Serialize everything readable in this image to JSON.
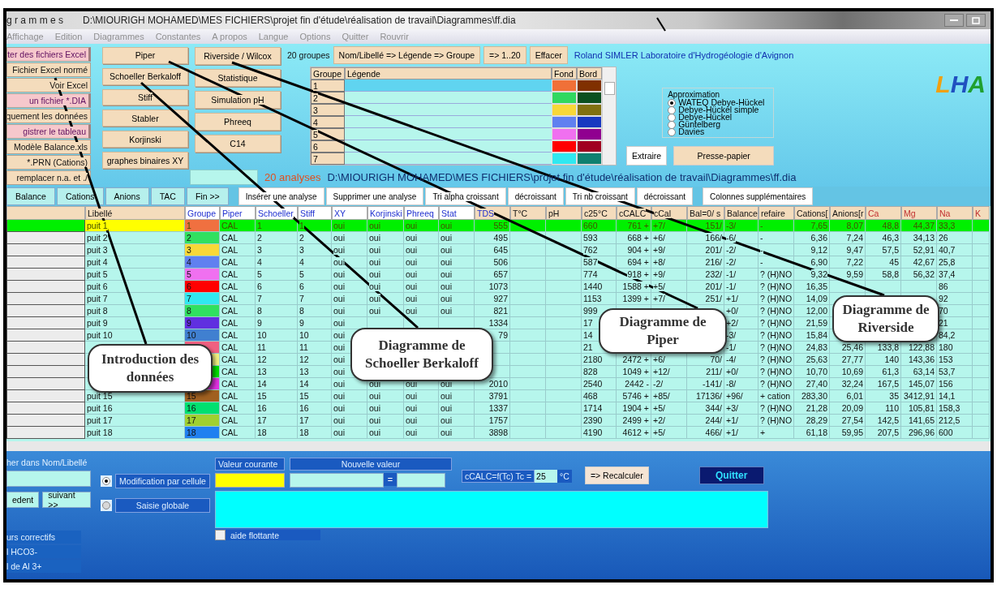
{
  "window": {
    "title": "g r a m m e s",
    "path": "D:\\MIOURIGH MOHAMED\\MES FICHIERS\\projet fin d'étude\\réalisation de travail\\Diagrammes\\ff.dia"
  },
  "menu": [
    "Affichage",
    "Edition",
    "Diagrammes",
    "Constantes",
    "A propos",
    "Langue",
    "Options",
    "Quitter",
    "Rouvrir"
  ],
  "file_buttons": [
    {
      "label": "ter des fichiers Excel",
      "kind": "pink"
    },
    {
      "label": "Fichier Excel normé",
      "kind": "beige"
    },
    {
      "label": "Voir Excel",
      "kind": "beige"
    },
    {
      "label": "un fichier *.DIA",
      "kind": "pink"
    },
    {
      "label": "quement les données",
      "kind": "beige"
    },
    {
      "label": "gistrer le tableau",
      "kind": "pink"
    },
    {
      "label": "Modèle Balance.xls",
      "kind": "beige"
    },
    {
      "label": "*.PRN (Cations)",
      "kind": "beige"
    },
    {
      "label": "remplacer n.a. et ./",
      "kind": "beige"
    }
  ],
  "diagram_buttons": [
    [
      "Piper",
      "Schoeller Berkaloff",
      "Stiff",
      "Stabler",
      "Korjinski",
      "graphes binaires XY"
    ],
    [
      "Riverside / Wilcox",
      "Statistique",
      "Simulation pH",
      "Phreeq",
      "C14"
    ]
  ],
  "groups": {
    "count_label": "20 groupes",
    "buttons": [
      "Nom/Libellé => Légende => Groupe",
      "=> 1..20",
      "Effacer"
    ],
    "credit": "Roland SIMLER Laboratoire d'Hydrogéologie d'Avignon",
    "columns": [
      "Groupe",
      "Légende",
      "Fond",
      "Bord"
    ],
    "rows": [
      {
        "group": "1",
        "selected": true,
        "swatches": [
          {
            "color": "#f07038"
          },
          {
            "color": "#803000"
          }
        ]
      },
      {
        "group": "2",
        "selected": false,
        "swatches": [
          {
            "color": "#30d860"
          },
          {
            "color": "#0a5020"
          }
        ]
      },
      {
        "group": "3",
        "selected": false,
        "swatches": [
          {
            "color": "#f8d838"
          },
          {
            "color": "#807010"
          }
        ]
      },
      {
        "group": "4",
        "selected": false,
        "swatches": [
          {
            "color": "#6080f0"
          },
          {
            "color": "#1838c0"
          }
        ]
      },
      {
        "group": "5",
        "selected": false,
        "swatches": [
          {
            "color": "#f070f0"
          },
          {
            "color": "#900090"
          }
        ]
      },
      {
        "group": "6",
        "selected": false,
        "swatches": [
          {
            "color": "#ff0000"
          },
          {
            "color": "#a00020"
          }
        ]
      },
      {
        "group": "7",
        "selected": false,
        "swatches": [
          {
            "color": "#30e8f0"
          },
          {
            "color": "#108070"
          }
        ]
      }
    ]
  },
  "approximation": {
    "title": "Approximation",
    "options": [
      {
        "label": "WATEQ Debye-Hückel",
        "selected": true
      },
      {
        "label": "Debye-Hückel simple",
        "selected": false
      },
      {
        "label": "Debye-Hückel",
        "selected": false
      },
      {
        "label": "Güntelberg",
        "selected": false
      },
      {
        "label": "Davies",
        "selected": false
      }
    ]
  },
  "extract_buttons": [
    "Extraire",
    "Presse-papier"
  ],
  "logo": [
    {
      "text": "L",
      "color": "#f0a010"
    },
    {
      "text": "H",
      "color": "#2050c0"
    },
    {
      "text": "A",
      "color": "#20a030"
    }
  ],
  "analyses": {
    "count": "20 analyses",
    "path": "D:\\MIOURIGH MOHAMED\\MES FICHIERS\\projet fin d'étude\\réalisation de travail\\Diagrammes\\ff.dia"
  },
  "tabs": [
    "Balance",
    "Cations",
    "Anions",
    "TAC",
    "Fin >>"
  ],
  "actions": [
    "Insérer une analyse",
    "Supprimer une analyse",
    "Tri alpha croissant",
    "décroissant",
    "Tri nb croissant",
    "décroissant",
    "Colonnes supplémentaires"
  ],
  "table": {
    "columns": [
      {
        "label": "Libellé",
        "kind": "plain"
      },
      {
        "label": "Groupe",
        "kind": "link"
      },
      {
        "label": "Piper",
        "kind": "link"
      },
      {
        "label": "Schoeller",
        "kind": "link"
      },
      {
        "label": "Stiff",
        "kind": "link"
      },
      {
        "label": "XY",
        "kind": "link"
      },
      {
        "label": "Korjinski",
        "kind": "link"
      },
      {
        "label": "Phreeq",
        "kind": "link"
      },
      {
        "label": "Stat",
        "kind": "link"
      },
      {
        "label": "TDS",
        "kind": "blue"
      },
      {
        "label": "T°C",
        "kind": "plain"
      },
      {
        "label": "pH",
        "kind": "plain"
      },
      {
        "label": "c25°C",
        "kind": "plain"
      },
      {
        "label": "cCALC",
        "kind": "plain"
      },
      {
        "label": "cCal",
        "kind": "plain"
      },
      {
        "label": "Bal=0/ s",
        "kind": "plain"
      },
      {
        "label": "Balance",
        "kind": "plain"
      },
      {
        "label": "refaire",
        "kind": "plain"
      },
      {
        "label": "Cations[",
        "kind": "plain"
      },
      {
        "label": "Anions[r",
        "kind": "plain"
      },
      {
        "label": "Ca",
        "kind": "ion"
      },
      {
        "label": "Mg",
        "kind": "ion"
      },
      {
        "label": "Na",
        "kind": "ion"
      },
      {
        "label": "K",
        "kind": "ion"
      }
    ],
    "rows": [
      {
        "selected": true,
        "color": "#f07040",
        "cells": [
          "puit 1",
          "1",
          "CAL",
          "1",
          "1",
          "oui",
          "oui",
          "oui",
          "oui",
          "555",
          null,
          null,
          "660",
          "761 +",
          "+7/",
          "151/",
          "-3/",
          "-",
          "7,65",
          "8,07",
          "48,8",
          "44,37",
          "33,3",
          null
        ]
      },
      {
        "selected": false,
        "color": "#30e060",
        "cells": [
          "puit 2",
          "2",
          "CAL",
          "2",
          "2",
          "oui",
          "oui",
          "oui",
          "oui",
          "495",
          null,
          null,
          "593",
          "668 +",
          "+6/",
          "166/",
          "-6/",
          "-",
          "6,36",
          "7,24",
          "46,3",
          "34,13",
          "26",
          null
        ]
      },
      {
        "selected": false,
        "color": "#f8d838",
        "cells": [
          "puit 3",
          "3",
          "CAL",
          "3",
          "3",
          "oui",
          "oui",
          "oui",
          "oui",
          "645",
          null,
          null,
          "762",
          "904 +",
          "+9/",
          "201/",
          "-2/",
          "-",
          "9,12",
          "9,47",
          "57,5",
          "52,91",
          "40,7",
          null
        ]
      },
      {
        "selected": false,
        "color": "#6080f0",
        "cells": [
          "puit 4",
          "4",
          "CAL",
          "4",
          "4",
          "oui",
          "oui",
          "oui",
          "oui",
          "506",
          null,
          null,
          "587",
          "694 +",
          "+8/",
          "216/",
          "-2/",
          "-",
          "6,90",
          "7,22",
          "45",
          "42,67",
          "25,8",
          null
        ]
      },
      {
        "selected": false,
        "color": "#f070f0",
        "cells": [
          "puit 5",
          "5",
          "CAL",
          "5",
          "5",
          "oui",
          "oui",
          "oui",
          "oui",
          "657",
          null,
          null,
          "774",
          "918 +",
          "+9/",
          "232/",
          "-1/",
          "? (H)NO",
          "9,32",
          "9,59",
          "58,8",
          "56,32",
          "37,4",
          null
        ]
      },
      {
        "selected": false,
        "color": "#ff0000",
        "cells": [
          "puit 6",
          "6",
          "CAL",
          "6",
          "6",
          "oui",
          "oui",
          "oui",
          "oui",
          "1073",
          null,
          null,
          "1440",
          "1588 +",
          "+5/",
          "201/",
          "-1/",
          "? (H)NO",
          "16,35",
          null,
          null,
          null,
          "86",
          null
        ]
      },
      {
        "selected": false,
        "color": "#30e8f0",
        "cells": [
          "puit 7",
          "7",
          "CAL",
          "7",
          "7",
          "oui",
          "oui",
          "oui",
          "oui",
          "927",
          null,
          null,
          "1153",
          "1399 +",
          "+7/",
          "251/",
          "+1/",
          "? (H)NO",
          "14,09",
          null,
          null,
          null,
          "92",
          null
        ]
      },
      {
        "selected": false,
        "color": "#30e060",
        "cells": [
          "puit 8",
          "8",
          "CAL",
          "8",
          "8",
          "oui",
          "oui",
          "oui",
          "oui",
          "821",
          null,
          null,
          "999",
          null,
          null,
          null,
          "+0/",
          "? (H)NO",
          "12,00",
          null,
          null,
          null,
          "70",
          null
        ]
      },
      {
        "selected": false,
        "color": "#6030e0",
        "cells": [
          "puit 9",
          "9",
          "CAL",
          "9",
          "9",
          "oui",
          null,
          null,
          null,
          "1334",
          null,
          null,
          "17",
          null,
          null,
          null,
          "+2/",
          "? (H)NO",
          "21,59",
          null,
          null,
          null,
          "21",
          null
        ]
      },
      {
        "selected": false,
        "color": "#4080d0",
        "cells": [
          "puit 10",
          "10",
          "CAL",
          "10",
          "10",
          "oui",
          null,
          null,
          null,
          "79",
          null,
          null,
          "14",
          null,
          null,
          null,
          "-3/",
          "? (H)NO",
          "15,84",
          null,
          null,
          null,
          "84,2",
          null
        ]
      },
      {
        "selected": false,
        "color": "#f06080",
        "cells": [
          null,
          null,
          "CAL",
          "11",
          "11",
          "oui",
          null,
          null,
          null,
          null,
          null,
          null,
          "21",
          null,
          null,
          null,
          "-1/",
          "? (H)NO",
          "24,83",
          "25,46",
          "133,8",
          "122,88",
          "180",
          null
        ]
      },
      {
        "selected": false,
        "color": "#f0f080",
        "cells": [
          null,
          null,
          "CAL",
          "12",
          "12",
          "oui",
          null,
          null,
          null,
          null,
          null,
          null,
          "2180",
          "2472 +",
          "+6/",
          "70/",
          "-4/",
          "? (H)NO",
          "25,63",
          "27,77",
          "140",
          "143,36",
          "153",
          null
        ]
      },
      {
        "selected": false,
        "color": "#00e000",
        "cells": [
          null,
          null,
          "CAL",
          "13",
          "13",
          "oui",
          null,
          null,
          null,
          null,
          null,
          null,
          "828",
          "1049 +",
          "+12/",
          "211/",
          "+0/",
          "? (H)NO",
          "10,70",
          "10,69",
          "61,3",
          "63,14",
          "53,7",
          null
        ]
      },
      {
        "selected": false,
        "color": "#e030e0",
        "cells": [
          null,
          null,
          "CAL",
          "14",
          "14",
          "oui",
          "oui",
          "oui",
          "oui",
          "2010",
          null,
          null,
          "2540",
          "2442 -",
          "-2/",
          "-141/",
          "-8/",
          "? (H)NO",
          "27,40",
          "32,24",
          "167,5",
          "145,07",
          "156",
          null
        ]
      },
      {
        "selected": false,
        "color": "#a06020",
        "cells": [
          "puit 15",
          "15",
          "CAL",
          "15",
          "15",
          "oui",
          "oui",
          "oui",
          "oui",
          "3791",
          null,
          null,
          "468",
          "5746 +",
          "+85/",
          "17136/",
          "+96/",
          "+ cation",
          "283,30",
          "6,01",
          "35",
          "3412,91",
          "14,1",
          null
        ]
      },
      {
        "selected": false,
        "color": "#00e070",
        "cells": [
          "puit 16",
          "16",
          "CAL",
          "16",
          "16",
          "oui",
          "oui",
          "oui",
          "oui",
          "1337",
          null,
          null,
          "1714",
          "1904 +",
          "+5/",
          "344/",
          "+3/",
          "? (H)NO",
          "21,28",
          "20,09",
          "110",
          "105,81",
          "158,3",
          null
        ]
      },
      {
        "selected": false,
        "color": "#a0d030",
        "cells": [
          "puit 17",
          "17",
          "CAL",
          "17",
          "17",
          "oui",
          "oui",
          "oui",
          "oui",
          "1757",
          null,
          null,
          "2390",
          "2499 +",
          "+2/",
          "244/",
          "+1/",
          "? (H)NO",
          "28,29",
          "27,54",
          "142,5",
          "141,65",
          "212,5",
          null
        ]
      },
      {
        "selected": false,
        "color": "#2080f0",
        "cells": [
          "puit 18",
          "18",
          "CAL",
          "18",
          "18",
          "oui",
          "oui",
          "oui",
          "oui",
          "3898",
          null,
          null,
          "4190",
          "4612 +",
          "+5/",
          "466/",
          "+1/",
          "+",
          "61,18",
          "59,95",
          "207,5",
          "296,96",
          "600",
          null
        ]
      }
    ]
  },
  "bottom": {
    "search_label": "her dans Nom/Libellé",
    "nav_buttons": [
      "edent",
      "suivant >>"
    ],
    "modes": [
      {
        "label": "Modification par cellule",
        "selected": true
      },
      {
        "label": "Saisie globale",
        "selected": false
      }
    ],
    "current_label": "Valeur courante",
    "new_label": "Nouvelle valeur",
    "equals": "=",
    "formula_label": "cCALC=f(Tc)  Tc =",
    "temperature": "25",
    "unit": "°C",
    "recalc": "=> Recalculer",
    "quit": "Quitter",
    "hint": {
      "label": "aide flottante",
      "checked": false
    },
    "notes": [
      "urs correctifs",
      "l HCO3-",
      "l de Al 3+"
    ]
  },
  "callouts": [
    {
      "text": "Introduction des données"
    },
    {
      "text": "Diagramme de Schoeller Berkaloff"
    },
    {
      "text": "Diagramme de Piper"
    },
    {
      "text": "Diagramme de Riverside"
    }
  ]
}
